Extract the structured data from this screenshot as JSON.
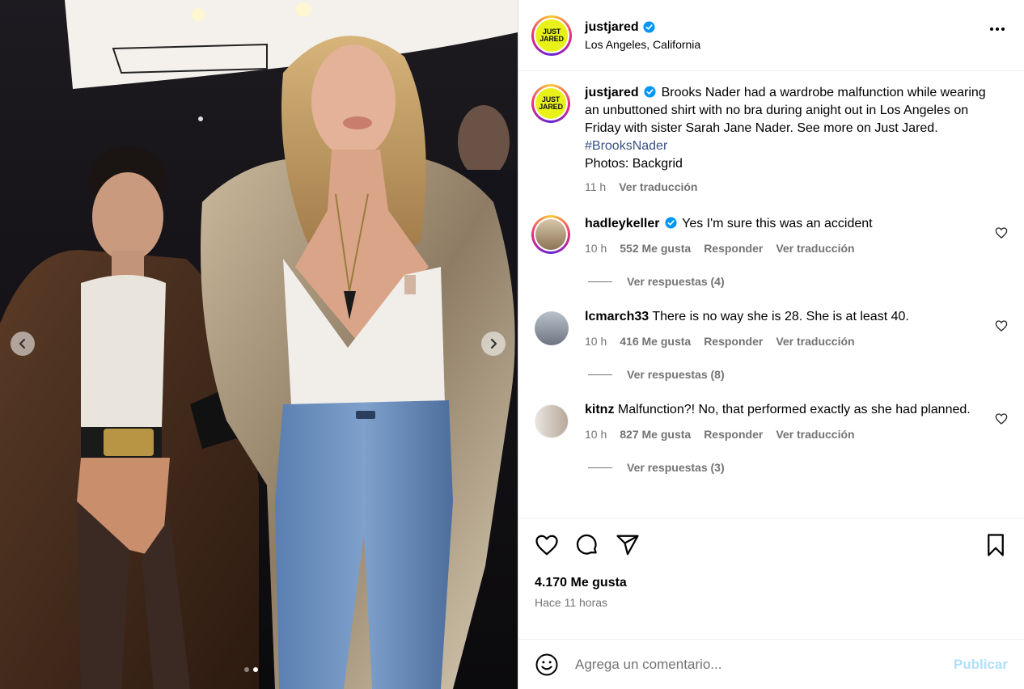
{
  "post": {
    "username": "justjared",
    "location": "Los Angeles, California",
    "logo_line1": "JUST",
    "logo_line2": "JARED",
    "caption_user": "justjared",
    "caption": "Brooks Nader had a wardrobe malfunction while wearing an unbuttoned shirt with no bra during anight out in Los Angeles on Friday with sister Sarah Jane Nader. See more on Just Jared.",
    "hashtag": "#BrooksNader",
    "credit": "Photos: Backgrid",
    "caption_time": "11 h",
    "caption_translate": "Ver traducción"
  },
  "comments": [
    {
      "user": "hadleykeller",
      "verified": true,
      "text": "Yes I'm sure this was an accident",
      "time": "10 h",
      "likes": "552 Me gusta",
      "reply": "Responder",
      "translate": "Ver traducción",
      "replies": "Ver respuestas (4)"
    },
    {
      "user": "lcmarch33",
      "verified": false,
      "text": "There is no way she is 28. She is at least 40.",
      "time": "10 h",
      "likes": "416 Me gusta",
      "reply": "Responder",
      "translate": "Ver traducción",
      "replies": "Ver respuestas (8)"
    },
    {
      "user": "kitnz",
      "verified": false,
      "text": "Malfunction?! No, that performed exactly as she had planned.",
      "time": "10 h",
      "likes": "827 Me gusta",
      "reply": "Responder",
      "translate": "Ver traducción",
      "replies": "Ver respuestas (3)"
    }
  ],
  "footer": {
    "likes": "4.170 Me gusta",
    "ago": "Hace 11 horas",
    "comment_placeholder": "Agrega un comentario...",
    "publish": "Publicar"
  },
  "carousel": {
    "count": 2,
    "active": 2
  },
  "colors": {
    "accent_link": "#385185",
    "publish_disabled": "#b2dffc",
    "verified": "#0095f6",
    "logo_bg": "#e8f21a"
  }
}
